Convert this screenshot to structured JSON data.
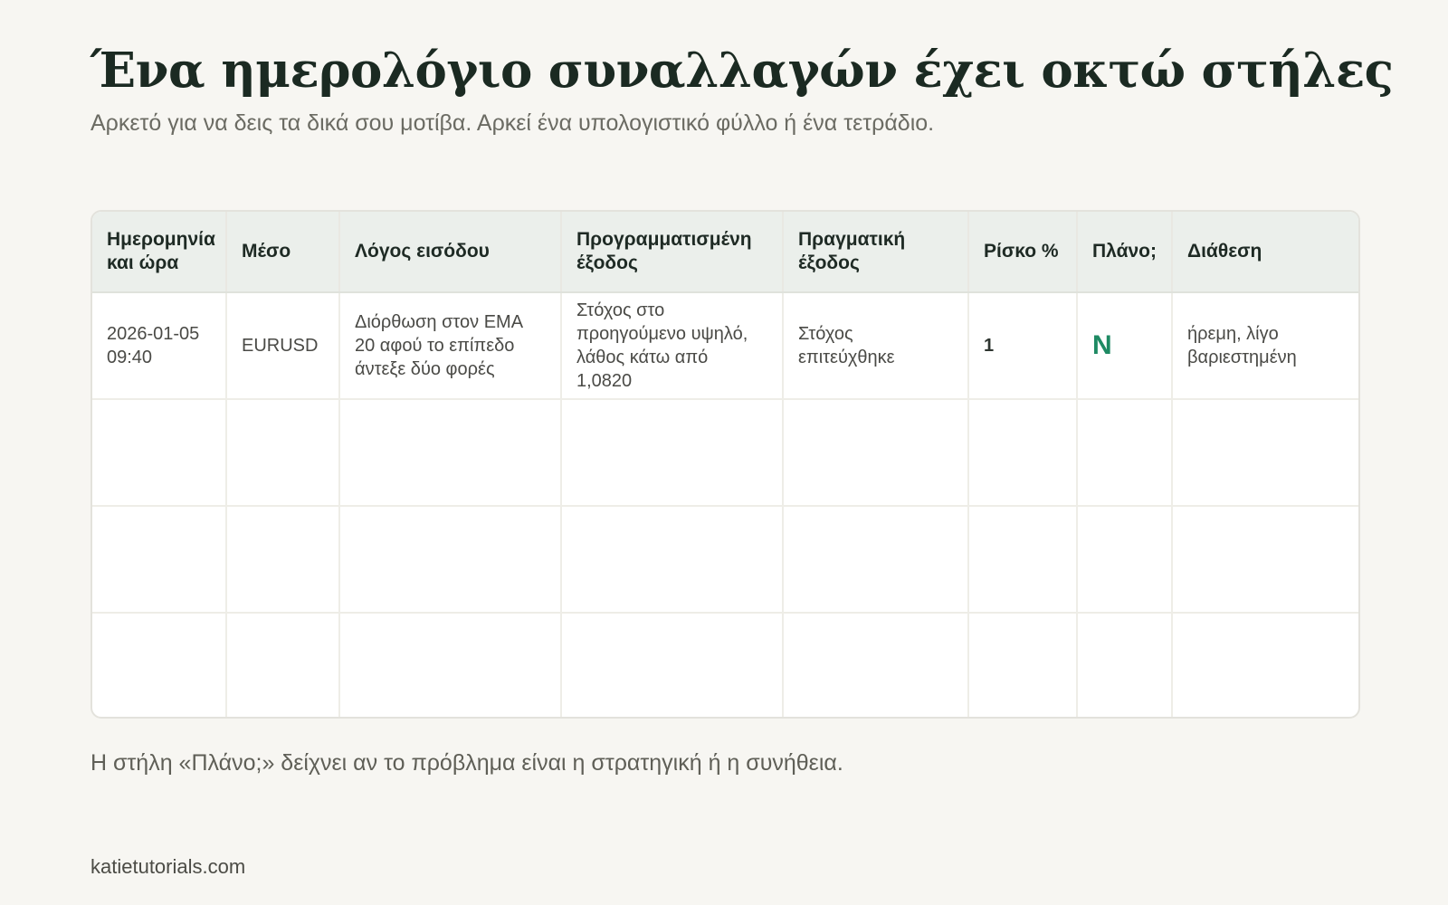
{
  "title": "Ένα ημερολόγιο συναλλαγών έχει οκτώ στήλες",
  "subtitle": "Αρκετό για να δεις τα δικά σου μοτίβα. Αρκεί ένα υπολογιστικό φύλλο ή ένα τετράδιο.",
  "table": {
    "headers": [
      "Ημερομηνία και ώρα",
      "Μέσο",
      "Λόγος εισόδου",
      "Προγραμματισμένη έξοδος",
      "Πραγματική έξοδος",
      "Ρίσκο %",
      "Πλάνο;",
      "Διάθεση"
    ],
    "rows": [
      [
        "2026-01-05 09:40",
        "EURUSD",
        "Διόρθωση στον EMA 20 αφού το επίπεδο άντεξε δύο φορές",
        "Στόχος στο προηγούμενο υψηλό, λάθος κάτω από 1,0820",
        "Στόχος επιτεύχθηκε",
        "1",
        "N",
        "ήρεμη, λίγο βαριεστημένη"
      ],
      [
        "",
        "",
        "",
        "",
        "",
        "",
        "",
        ""
      ],
      [
        "",
        "",
        "",
        "",
        "",
        "",
        "",
        ""
      ],
      [
        "",
        "",
        "",
        "",
        "",
        "",
        "",
        ""
      ]
    ]
  },
  "note": "Η στήλη «Πλάνο;» δείχνει αν το πρόβλημα είναι η στρατηγική ή η συνήθεια.",
  "footer": "katietutorials.com",
  "colors": {
    "background": "#f7f6f2",
    "header_background": "#ebefeb",
    "plan_accent": "#1e8a63",
    "title": "#1b2a22"
  }
}
